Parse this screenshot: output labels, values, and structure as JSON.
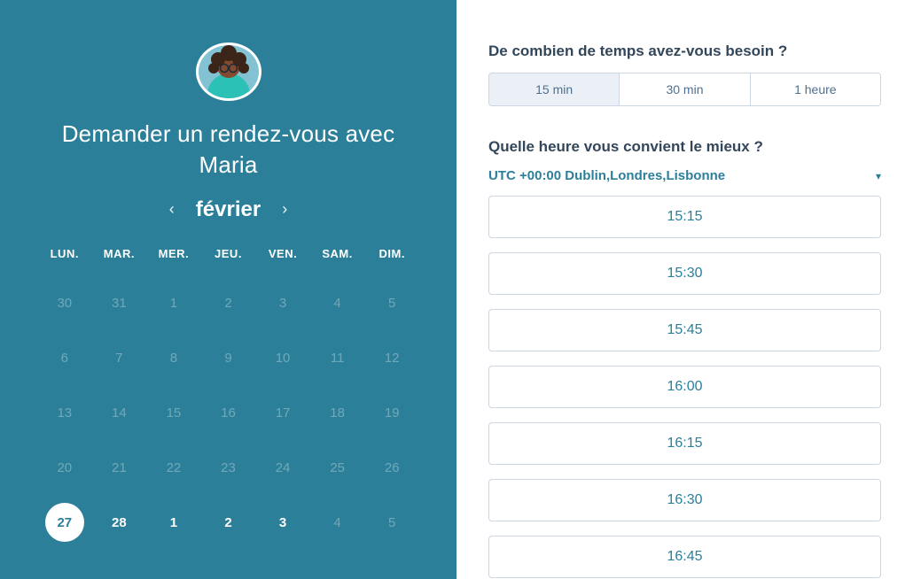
{
  "left": {
    "heading": "Demander un rendez-vous avec Maria",
    "month": "février",
    "weekdays": [
      "LUN.",
      "MAR.",
      "MER.",
      "JEU.",
      "VEN.",
      "SAM.",
      "DIM."
    ],
    "weeks": [
      [
        {
          "n": "30",
          "state": "dim"
        },
        {
          "n": "31",
          "state": "dim"
        },
        {
          "n": "1",
          "state": "dim"
        },
        {
          "n": "2",
          "state": "dim"
        },
        {
          "n": "3",
          "state": "dim"
        },
        {
          "n": "4",
          "state": "dim"
        },
        {
          "n": "5",
          "state": "dim"
        }
      ],
      [
        {
          "n": "6",
          "state": "dim"
        },
        {
          "n": "7",
          "state": "dim"
        },
        {
          "n": "8",
          "state": "dim"
        },
        {
          "n": "9",
          "state": "dim"
        },
        {
          "n": "10",
          "state": "dim"
        },
        {
          "n": "11",
          "state": "dim"
        },
        {
          "n": "12",
          "state": "dim"
        }
      ],
      [
        {
          "n": "13",
          "state": "dim"
        },
        {
          "n": "14",
          "state": "dim"
        },
        {
          "n": "15",
          "state": "dim"
        },
        {
          "n": "16",
          "state": "dim"
        },
        {
          "n": "17",
          "state": "dim"
        },
        {
          "n": "18",
          "state": "dim"
        },
        {
          "n": "19",
          "state": "dim"
        }
      ],
      [
        {
          "n": "20",
          "state": "dim"
        },
        {
          "n": "21",
          "state": "dim"
        },
        {
          "n": "22",
          "state": "dim"
        },
        {
          "n": "23",
          "state": "dim"
        },
        {
          "n": "24",
          "state": "dim"
        },
        {
          "n": "25",
          "state": "dim"
        },
        {
          "n": "26",
          "state": "dim"
        }
      ],
      [
        {
          "n": "27",
          "state": "selected"
        },
        {
          "n": "28",
          "state": "enabled"
        },
        {
          "n": "1",
          "state": "enabled"
        },
        {
          "n": "2",
          "state": "enabled"
        },
        {
          "n": "3",
          "state": "enabled"
        },
        {
          "n": "4",
          "state": "dim"
        },
        {
          "n": "5",
          "state": "dim"
        }
      ]
    ]
  },
  "right": {
    "duration_question": "De combien de temps avez-vous besoin ?",
    "durations": [
      {
        "label": "15 min",
        "active": true
      },
      {
        "label": "30 min",
        "active": false
      },
      {
        "label": "1 heure",
        "active": false
      }
    ],
    "time_question": "Quelle heure vous convient le mieux ?",
    "timezone": "UTC +00:00 Dublin,Londres,Lisbonne",
    "slots": [
      "15:15",
      "15:30",
      "15:45",
      "16:00",
      "16:15",
      "16:30",
      "16:45"
    ]
  }
}
